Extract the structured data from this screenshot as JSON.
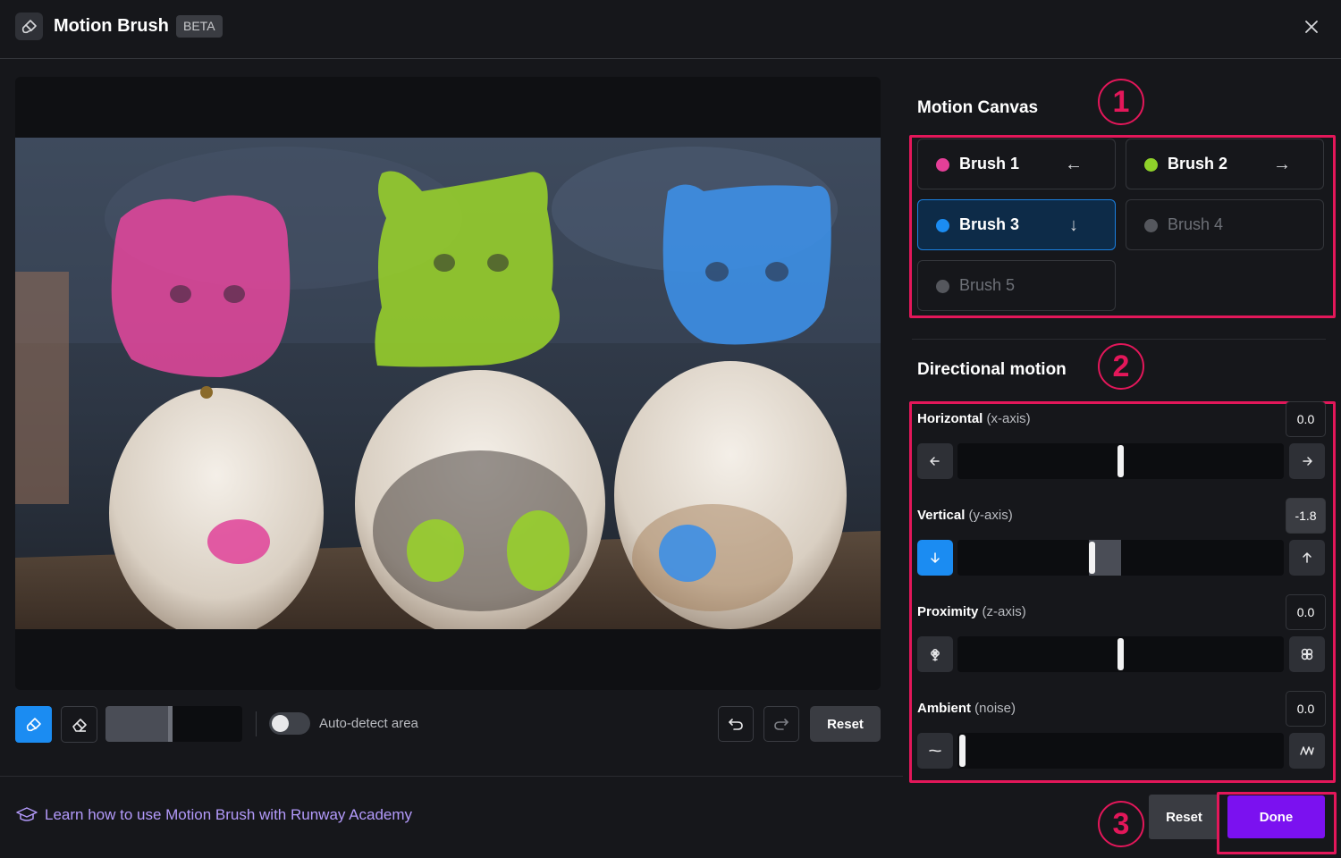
{
  "header": {
    "title": "Motion Brush",
    "badge": "BETA",
    "app_icon": "brush-icon",
    "close_icon": "close-icon"
  },
  "preview": {
    "image_description_icon": "cat-photo",
    "overlay_colors": [
      "#e0479b",
      "#98d22a",
      "#3d8fe6"
    ]
  },
  "toolbar": {
    "brush_tool_icon": "brush-icon",
    "eraser_tool_icon": "eraser-icon",
    "brush_size_fraction": 0.5,
    "auto_detect_label": "Auto-detect area",
    "auto_detect_on": false,
    "undo_icon": "undo-icon",
    "redo_icon": "redo-icon",
    "reset_label": "Reset"
  },
  "motion_canvas": {
    "title": "Motion Canvas",
    "badge": "1",
    "brushes": [
      {
        "label": "Brush 1",
        "color": "#e53f98",
        "arrow": "←",
        "active": true,
        "selected": false
      },
      {
        "label": "Brush 2",
        "color": "#8fd12a",
        "arrow": "→",
        "active": true,
        "selected": false
      },
      {
        "label": "Brush 3",
        "color": "#1b8cf2",
        "arrow": "↓",
        "active": true,
        "selected": true
      },
      {
        "label": "Brush 4",
        "color": "#55575d",
        "arrow": "",
        "active": false,
        "selected": false
      },
      {
        "label": "Brush 5",
        "color": "#55575d",
        "arrow": "",
        "active": false,
        "selected": false
      }
    ]
  },
  "directional_motion": {
    "title": "Directional motion",
    "badge": "2",
    "controls": [
      {
        "name": "Horizontal",
        "axis": "(x-axis)",
        "value": "0.0",
        "position": 0.5,
        "left_icon": "arrow-left-icon",
        "right_icon": "arrow-right-icon"
      },
      {
        "name": "Vertical",
        "axis": "(y-axis)",
        "value": "-1.8",
        "position": 0.41,
        "left_icon": "arrow-down-icon",
        "right_icon": "arrow-up-icon"
      },
      {
        "name": "Proximity",
        "axis": "(z-axis)",
        "value": "0.0",
        "position": 0.5,
        "left_icon": "zoom-out-icon",
        "right_icon": "zoom-in-icon"
      },
      {
        "name": "Ambient",
        "axis": "(noise)",
        "value": "0.0",
        "position": 0.0,
        "left_icon": "low-noise-icon",
        "right_icon": "high-noise-icon"
      }
    ]
  },
  "footer": {
    "learn_icon": "graduation-cap-icon",
    "learn_link": "Learn how to use Motion Brush with Runway Academy",
    "reset_label": "Reset",
    "done_label": "Done",
    "badge": "3"
  },
  "colors": {
    "accent_blue": "#1b8cf2",
    "done_purple": "#7b11f0",
    "highlight": "#e3175a",
    "link": "#b39afb"
  }
}
